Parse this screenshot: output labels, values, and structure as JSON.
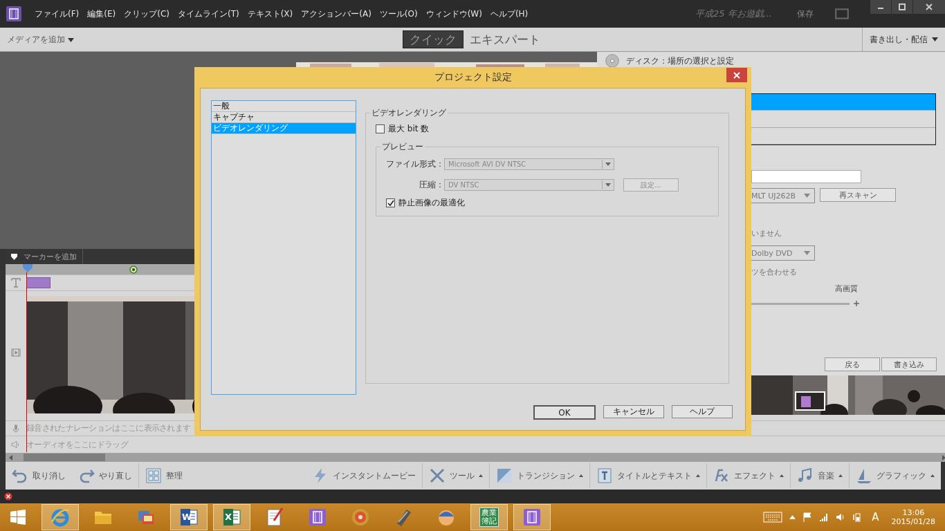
{
  "app": {
    "menu": [
      "ファイル(F)",
      "編集(E)",
      "クリップ(C)",
      "タイムライン(T)",
      "テキスト(X)",
      "アクションバー(A)",
      "ツール(O)",
      "ウィンドウ(W)",
      "ヘルプ(H)"
    ],
    "project_name": "平成25 年お遊戯...",
    "save": "保存"
  },
  "mode_bar": {
    "add_media": "メディアを追加",
    "tabs": [
      {
        "label": "クイック",
        "selected": true
      },
      {
        "label": "エキスパート",
        "selected": false
      }
    ],
    "export": "書き出し・配信"
  },
  "right_panel": {
    "heading": "ディスク：場所の選択と設定",
    "list_rows": [
      {
        "selected": true
      },
      {
        "selected": false
      },
      {
        "selected": false
      }
    ],
    "drive": "MLT UJ262B",
    "rescan": "再スキャン",
    "status_text": "いません",
    "format": "Dolby DVD",
    "fit_text": "ツを合わせる",
    "quality_label": "高画質",
    "back": "戻る",
    "burn": "書き込み"
  },
  "timeline": {
    "marker_button": "マーカーを追加",
    "narration_hint": "録音されたナレーションはここに表示されます",
    "audio_hint": "オーディオをここにドラッグ"
  },
  "toolbar": {
    "left": [
      {
        "kind": "undo",
        "label": "取り消し"
      },
      {
        "kind": "redo",
        "label": "やり直し"
      },
      {
        "kind": "organize",
        "label": "整理"
      }
    ],
    "right": [
      {
        "kind": "instant",
        "label": "インスタントムービー",
        "menu": false
      },
      {
        "kind": "tools",
        "label": "ツール",
        "menu": true
      },
      {
        "kind": "transition",
        "label": "トランジション",
        "menu": true
      },
      {
        "kind": "title",
        "label": "タイトルとテキスト",
        "menu": true
      },
      {
        "kind": "effect",
        "label": "エフェクト",
        "menu": true
      },
      {
        "kind": "music",
        "label": "音楽",
        "menu": true
      },
      {
        "kind": "graphic",
        "label": "グラフィック",
        "menu": true
      }
    ]
  },
  "dialog": {
    "title": "プロジェクト設定",
    "categories": [
      {
        "label": "一般",
        "selected": false
      },
      {
        "label": "キャプチャ",
        "selected": false
      },
      {
        "label": "ビデオレンダリング",
        "selected": true
      }
    ],
    "group_title": "ビデオレンダリング",
    "max_bit": {
      "label": "最大 bit 数",
      "checked": false
    },
    "preview_title": "プレビュー",
    "file_format": {
      "label": "ファイル形式：",
      "value": "Microsoft AVI DV NTSC",
      "disabled": true
    },
    "compression": {
      "label": "圧縮：",
      "value": "DV NTSC",
      "disabled": true
    },
    "settings_button": "設定...",
    "optimize": {
      "label": "静止画像の最適化",
      "checked": true
    },
    "buttons": [
      "OK",
      "キャンセル",
      "ヘルプ"
    ]
  },
  "taskbar": {
    "apps": [
      {
        "kind": "browser",
        "running": true
      },
      {
        "kind": "folder",
        "running": false
      },
      {
        "kind": "pictures",
        "running": false
      },
      {
        "kind": "word",
        "letter": "W",
        "running": true
      },
      {
        "kind": "excel",
        "letter": "X",
        "running": true
      },
      {
        "kind": "notepad",
        "running": false
      },
      {
        "kind": "film",
        "running": false
      },
      {
        "kind": "disc",
        "running": false
      },
      {
        "kind": "tool",
        "running": false
      },
      {
        "kind": "mascot",
        "running": false
      },
      {
        "kind": "ledger",
        "label": "農業簿記",
        "running": true
      },
      {
        "kind": "film",
        "running": true
      }
    ],
    "ime": "A",
    "time": "13:06",
    "date": "2015/01/28"
  }
}
